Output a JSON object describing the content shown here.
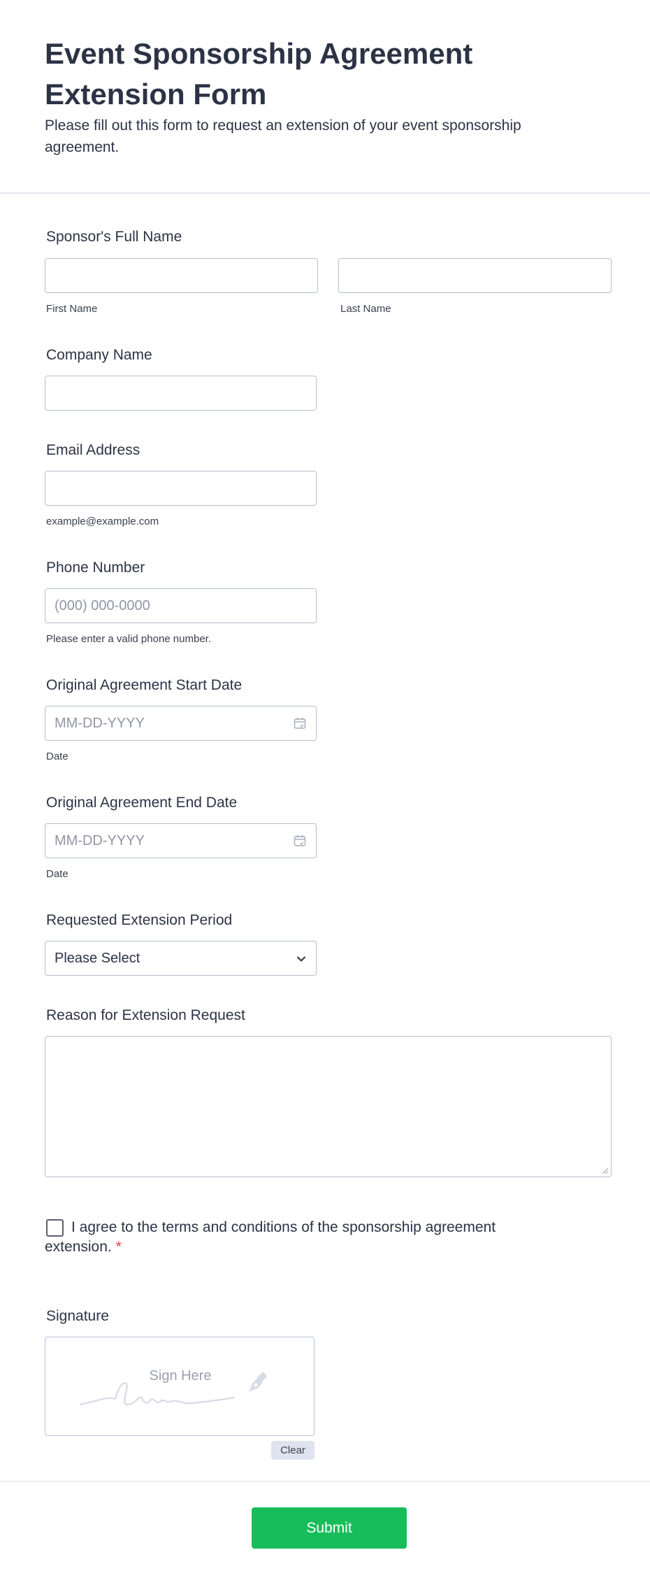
{
  "header": {
    "title": "Event Sponsorship Agreement Extension Form",
    "subtitle": "Please fill out this form to request an extension of your event sponsorship agreement."
  },
  "fields": {
    "full_name": {
      "label": "Sponsor's Full Name",
      "first_sublabel": "First Name",
      "last_sublabel": "Last Name",
      "first_value": "",
      "last_value": ""
    },
    "company": {
      "label": "Company Name",
      "value": ""
    },
    "email": {
      "label": "Email Address",
      "value": "",
      "sublabel": "example@example.com"
    },
    "phone": {
      "label": "Phone Number",
      "placeholder": "(000) 000-0000",
      "sublabel": "Please enter a valid phone number."
    },
    "start_date": {
      "label": "Original Agreement Start Date",
      "placeholder": "MM-DD-YYYY",
      "sublabel": "Date",
      "icon": "calendar-icon"
    },
    "end_date": {
      "label": "Original Agreement End Date",
      "placeholder": "MM-DD-YYYY",
      "sublabel": "Date",
      "icon": "calendar-icon"
    },
    "extension_period": {
      "label": "Requested Extension Period",
      "selected": "Please Select",
      "icon": "chevron-down-icon"
    },
    "reason": {
      "label": "Reason for Extension Request",
      "value": ""
    },
    "agree": {
      "text": "I agree to the terms and conditions of the sponsorship agreement extension.",
      "required_mark": "*",
      "checked": false
    },
    "signature": {
      "label": "Signature",
      "placeholder": "Sign Here",
      "clear_label": "Clear",
      "icon": "pen-nib-icon"
    }
  },
  "submit": {
    "label": "Submit"
  },
  "colors": {
    "text": "#2c3345",
    "border": "#b8bdc9",
    "placeholder": "#8f96a3",
    "required": "#f23a3c",
    "submit": "#18bd5b",
    "clear_button": "#dfe3ef"
  }
}
